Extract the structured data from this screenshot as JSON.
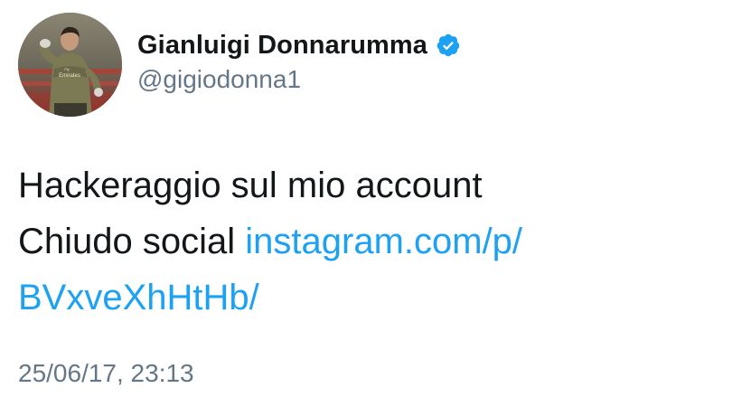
{
  "author": {
    "display_name": "Gianluigi Donnarumma",
    "handle": "@gigiodonna1",
    "verified": true,
    "verified_icon": "verified-badge-icon",
    "avatar_icon": "profile-photo"
  },
  "avatar_lettering": "Fly Emirates",
  "tweet": {
    "line1": "Hackeraggio sul mio account",
    "line2_text": "Chiudo social",
    "link_part1": "instagram.com/p/",
    "link_part2": "BVxveXhHtHb/",
    "timestamp": "25/06/17, 23:13"
  },
  "colors": {
    "link": "#1da1f2",
    "verified": "#1da1f2",
    "secondary_text": "#657786",
    "primary_text": "#14171a"
  }
}
